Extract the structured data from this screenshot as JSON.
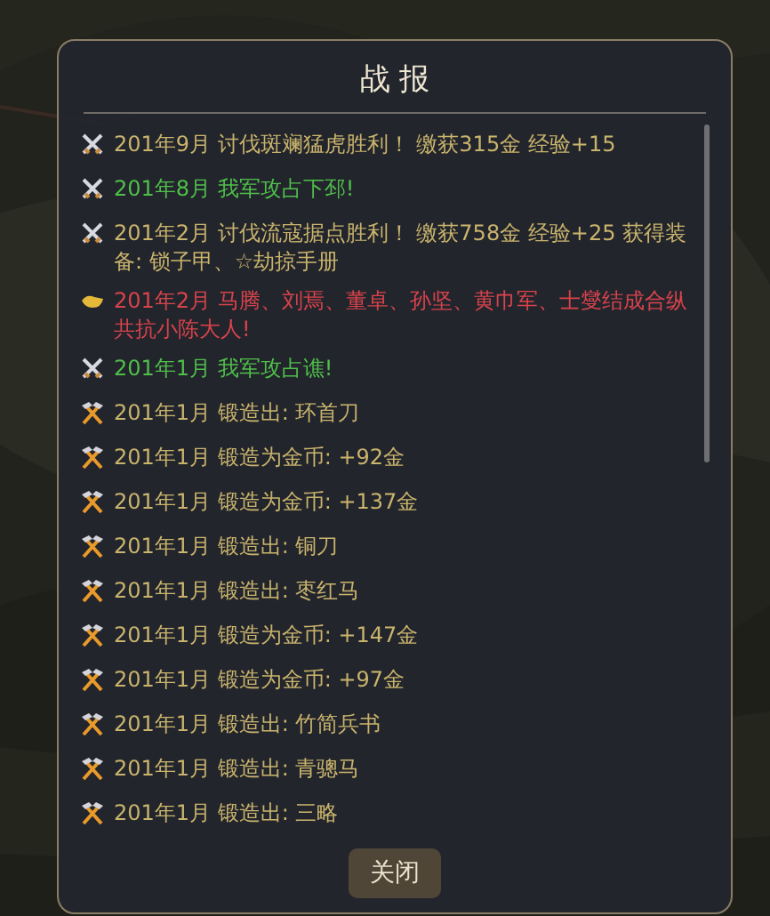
{
  "dialog": {
    "title": "战 报",
    "close_button": "关闭"
  },
  "entries": [
    {
      "kind": "battle",
      "color": "#c9b46c",
      "text": "201年9月 讨伐斑斓猛虎胜利！ 缴获315金 经验+15"
    },
    {
      "kind": "battle",
      "color": "#4fbf4a",
      "text": "201年8月 我军攻占下邳!"
    },
    {
      "kind": "battle",
      "color": "#c9b46c",
      "text": "201年2月 讨伐流寇据点胜利！ 缴获758金 经验+25 获得装备: 锁子甲、☆劫掠手册"
    },
    {
      "kind": "alliance",
      "color": "#d8434b",
      "text": "201年2月 马腾、刘焉、董卓、孙坚、黄巾军、士燮结成合纵共抗小陈大人!"
    },
    {
      "kind": "battle",
      "color": "#4fbf4a",
      "text": "201年1月 我军攻占谯!"
    },
    {
      "kind": "forge",
      "color": "#c9b46c",
      "text": "201年1月 锻造出: 环首刀"
    },
    {
      "kind": "forge",
      "color": "#c9b46c",
      "text": "201年1月 锻造为金币: +92金"
    },
    {
      "kind": "forge",
      "color": "#c9b46c",
      "text": "201年1月 锻造为金币: +137金"
    },
    {
      "kind": "forge",
      "color": "#c9b46c",
      "text": "201年1月 锻造出: 铜刀"
    },
    {
      "kind": "forge",
      "color": "#c9b46c",
      "text": "201年1月 锻造出: 枣红马"
    },
    {
      "kind": "forge",
      "color": "#c9b46c",
      "text": "201年1月 锻造为金币: +147金"
    },
    {
      "kind": "forge",
      "color": "#c9b46c",
      "text": "201年1月 锻造为金币: +97金"
    },
    {
      "kind": "forge",
      "color": "#c9b46c",
      "text": "201年1月 锻造出: 竹简兵书"
    },
    {
      "kind": "forge",
      "color": "#c9b46c",
      "text": "201年1月 锻造出: 青骢马"
    },
    {
      "kind": "forge",
      "color": "#c9b46c",
      "text": "201年1月 锻造出: 三略"
    }
  ]
}
